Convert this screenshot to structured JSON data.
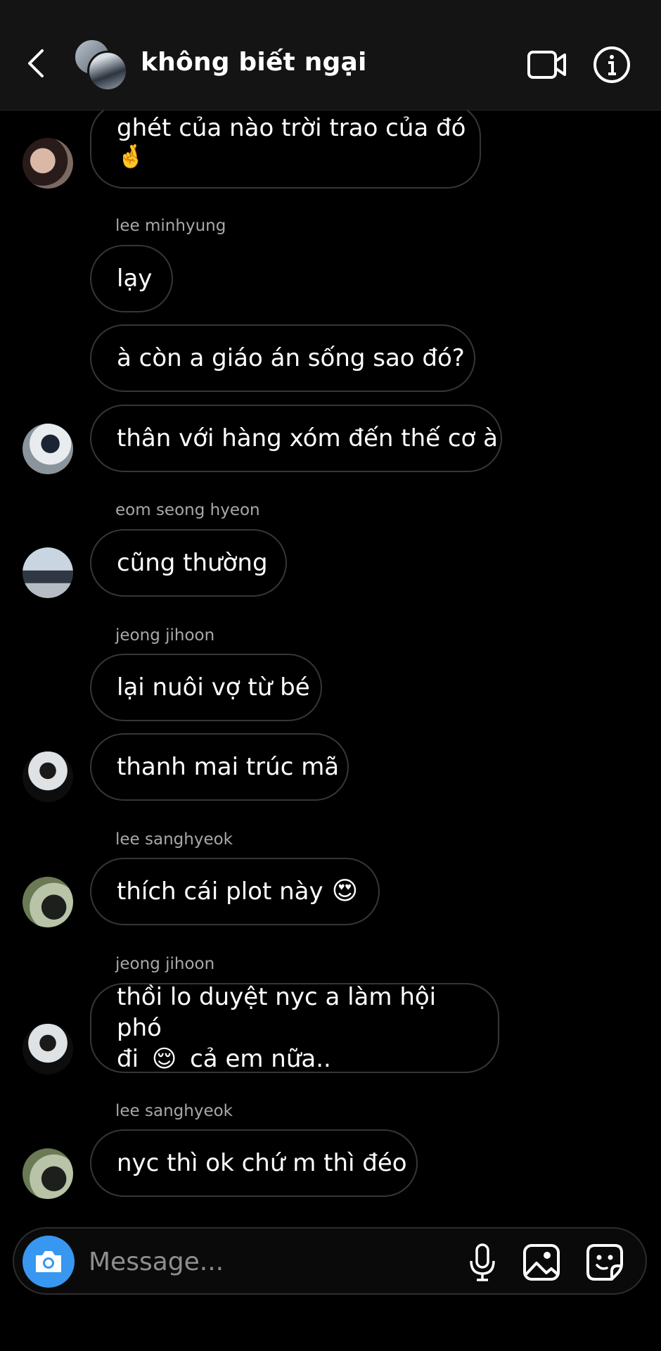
{
  "header": {
    "title": "không biết ngại",
    "icons": {
      "back": "chevron-left-icon",
      "video": "video-camera-icon",
      "info": "info-icon"
    }
  },
  "messages": [
    {
      "sender": "",
      "text": "ghét của nào trời trao của đó",
      "emoji": "🤞"
    },
    {
      "sender": "lee minhyung",
      "text": "lạy"
    },
    {
      "sender": "",
      "text": "à còn a giáo án sống sao đó?"
    },
    {
      "sender": "",
      "text": "thân với hàng xóm đến thế cơ à"
    },
    {
      "sender": "eom seong hyeon",
      "text": "cũng thường"
    },
    {
      "sender": "jeong jihoon",
      "text": "lại nuôi vợ từ bé"
    },
    {
      "sender": "",
      "text": "thanh mai trúc mã"
    },
    {
      "sender": "lee sanghyeok",
      "text": "thích cái plot này",
      "emoji": "😍"
    },
    {
      "sender": "jeong jihoon",
      "text_line1": "thồi lo duyệt nyc a làm hội phó",
      "text_line2_a": "đi",
      "text_line2_emoji": "😌",
      "text_line2_b": "cả em nữa.."
    },
    {
      "sender": "lee sanghyeok",
      "text": "nyc thì ok chứ m thì đéo"
    }
  ],
  "composer": {
    "placeholder": "Message...",
    "icons": {
      "camera": "camera-icon",
      "mic": "microphone-icon",
      "gallery": "image-icon",
      "sticker": "sticker-icon"
    }
  },
  "colors": {
    "accent": "#3897f0",
    "bubble_border": "#363636",
    "sender_gray": "#a8a8a8",
    "header_bg": "#141414"
  }
}
